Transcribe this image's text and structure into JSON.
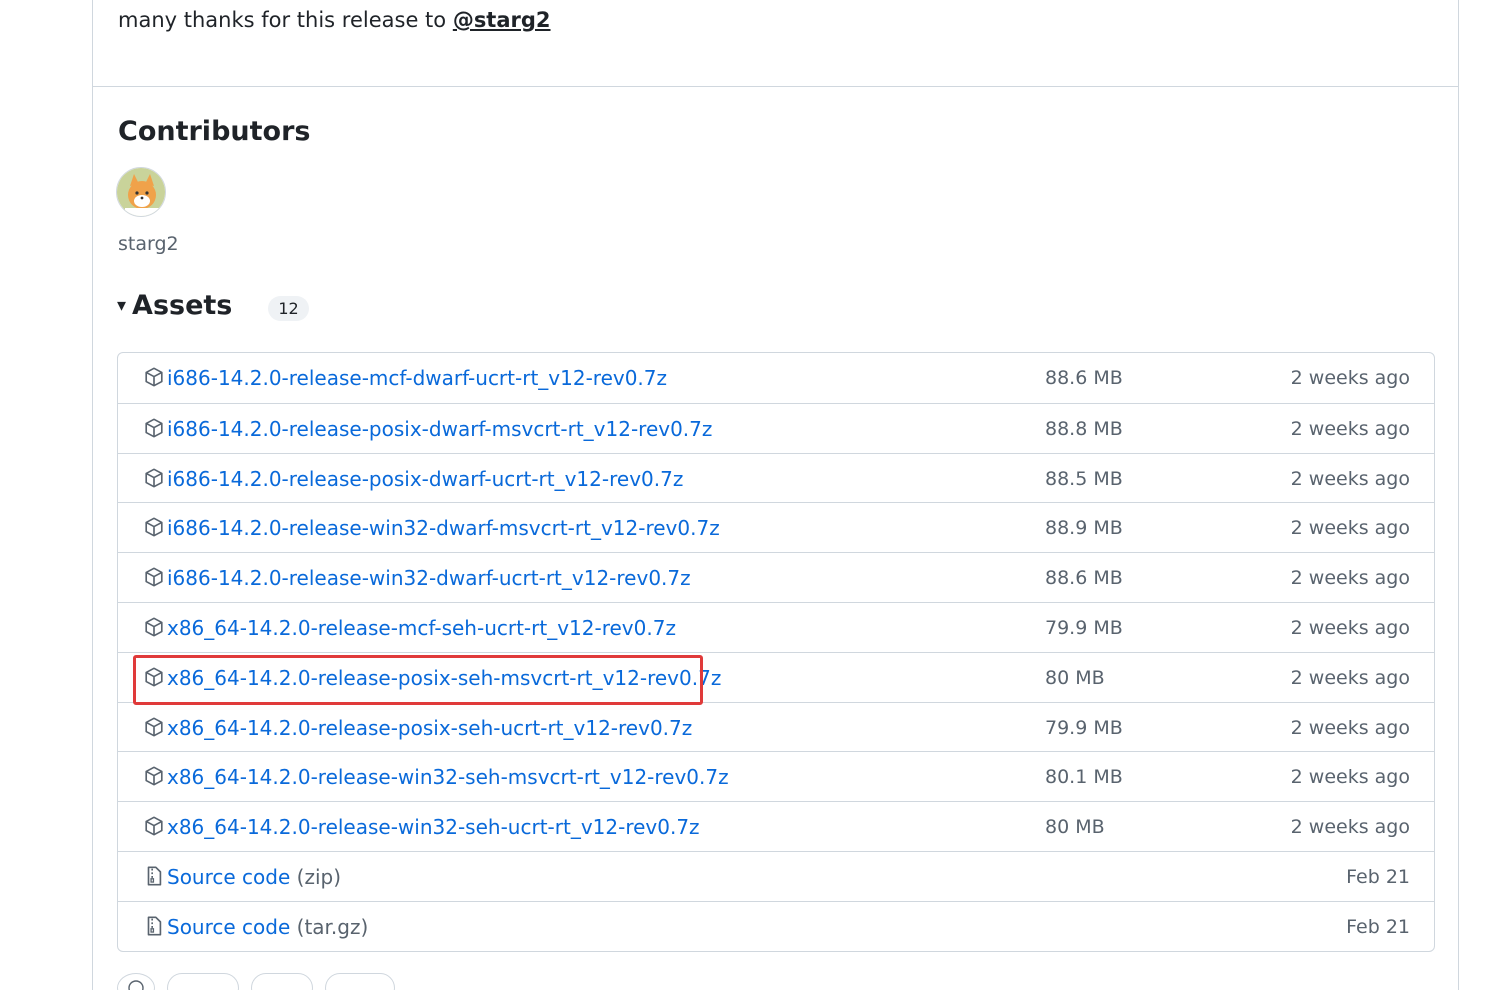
{
  "release_note": {
    "thanks_text": "many thanks for this release to",
    "mention": "@starg2"
  },
  "contributors": {
    "title": "Contributors",
    "users": [
      {
        "name": "starg2",
        "avatar_icon": "fox-avatar"
      }
    ]
  },
  "assets": {
    "caret": "▾",
    "title": "Assets",
    "count": "12",
    "items": [
      {
        "name": "i686-14.2.0-release-mcf-dwarf-ucrt-rt_v12-rev0.7z",
        "suffix": "",
        "size": "88.6 MB",
        "date": "2 weeks ago",
        "icon": "package-icon"
      },
      {
        "name": "i686-14.2.0-release-posix-dwarf-msvcrt-rt_v12-rev0.7z",
        "suffix": "",
        "size": "88.8 MB",
        "date": "2 weeks ago",
        "icon": "package-icon"
      },
      {
        "name": "i686-14.2.0-release-posix-dwarf-ucrt-rt_v12-rev0.7z",
        "suffix": "",
        "size": "88.5 MB",
        "date": "2 weeks ago",
        "icon": "package-icon"
      },
      {
        "name": "i686-14.2.0-release-win32-dwarf-msvcrt-rt_v12-rev0.7z",
        "suffix": "",
        "size": "88.9 MB",
        "date": "2 weeks ago",
        "icon": "package-icon"
      },
      {
        "name": "i686-14.2.0-release-win32-dwarf-ucrt-rt_v12-rev0.7z",
        "suffix": "",
        "size": "88.6 MB",
        "date": "2 weeks ago",
        "icon": "package-icon"
      },
      {
        "name": "x86_64-14.2.0-release-mcf-seh-ucrt-rt_v12-rev0.7z",
        "suffix": "",
        "size": "79.9 MB",
        "date": "2 weeks ago",
        "icon": "package-icon"
      },
      {
        "name": "x86_64-14.2.0-release-posix-seh-msvcrt-rt_v12-rev0.7z",
        "suffix": "",
        "size": "80 MB",
        "date": "2 weeks ago",
        "icon": "package-icon"
      },
      {
        "name": "x86_64-14.2.0-release-posix-seh-ucrt-rt_v12-rev0.7z",
        "suffix": "",
        "size": "79.9 MB",
        "date": "2 weeks ago",
        "icon": "package-icon"
      },
      {
        "name": "x86_64-14.2.0-release-win32-seh-msvcrt-rt_v12-rev0.7z",
        "suffix": "",
        "size": "80.1 MB",
        "date": "2 weeks ago",
        "icon": "package-icon"
      },
      {
        "name": "x86_64-14.2.0-release-win32-seh-ucrt-rt_v12-rev0.7z",
        "suffix": "",
        "size": "80 MB",
        "date": "2 weeks ago",
        "icon": "package-icon"
      },
      {
        "name": "Source code",
        "suffix": "(zip)",
        "size": "",
        "date": "Feb 21",
        "icon": "file-zip-icon"
      },
      {
        "name": "Source code",
        "suffix": "(tar.gz)",
        "size": "",
        "date": "Feb 21",
        "icon": "file-zip-icon"
      }
    ]
  },
  "highlight": {
    "color": "#e03a3a",
    "item_name": "x86_64-14.2.0-release-posix-seh-msvcrt-rt_v12-rev0.7z"
  },
  "colors": {
    "link": "#0969da",
    "muted": "#59636e",
    "border": "#d0d7de"
  }
}
